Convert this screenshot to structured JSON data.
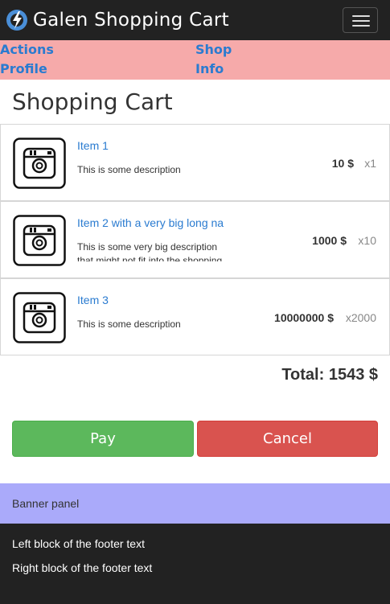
{
  "navbar": {
    "brand": "Galen Shopping Cart",
    "brand_icon": "galen-logo-icon",
    "toggle_icon": "hamburger-menu-icon"
  },
  "menu": {
    "items": [
      {
        "label": "Actions"
      },
      {
        "label": "Shop"
      },
      {
        "label": "Profile"
      },
      {
        "label": "Info"
      }
    ]
  },
  "page": {
    "title": "Shopping Cart"
  },
  "cart": {
    "items": [
      {
        "icon": "camera-icon",
        "name": "Item 1",
        "description": "This is some description",
        "price": "10 $",
        "quantity": "x1"
      },
      {
        "icon": "camera-icon",
        "name": "Item 2 with a very big long na",
        "description": "This is some very big description that might not fit into the shopping",
        "price": "1000 $",
        "quantity": "x10"
      },
      {
        "icon": "camera-icon",
        "name": "Item 3",
        "description": "This is some description",
        "price": "10000000 $",
        "quantity": "x2000"
      }
    ],
    "total": "Total: 1543 $"
  },
  "actions": {
    "pay_label": "Pay",
    "cancel_label": "Cancel"
  },
  "banner": {
    "text": "Banner panel"
  },
  "footer": {
    "left": "Left block of the footer text",
    "right": "Right block of the footer text"
  },
  "colors": {
    "navbar": "#222222",
    "menu": "#f6aaaa",
    "link": "#2a7bd0",
    "pay": "#5cb85c",
    "cancel": "#d9534f",
    "banner": "#aaaafa",
    "footer": "#222222"
  }
}
